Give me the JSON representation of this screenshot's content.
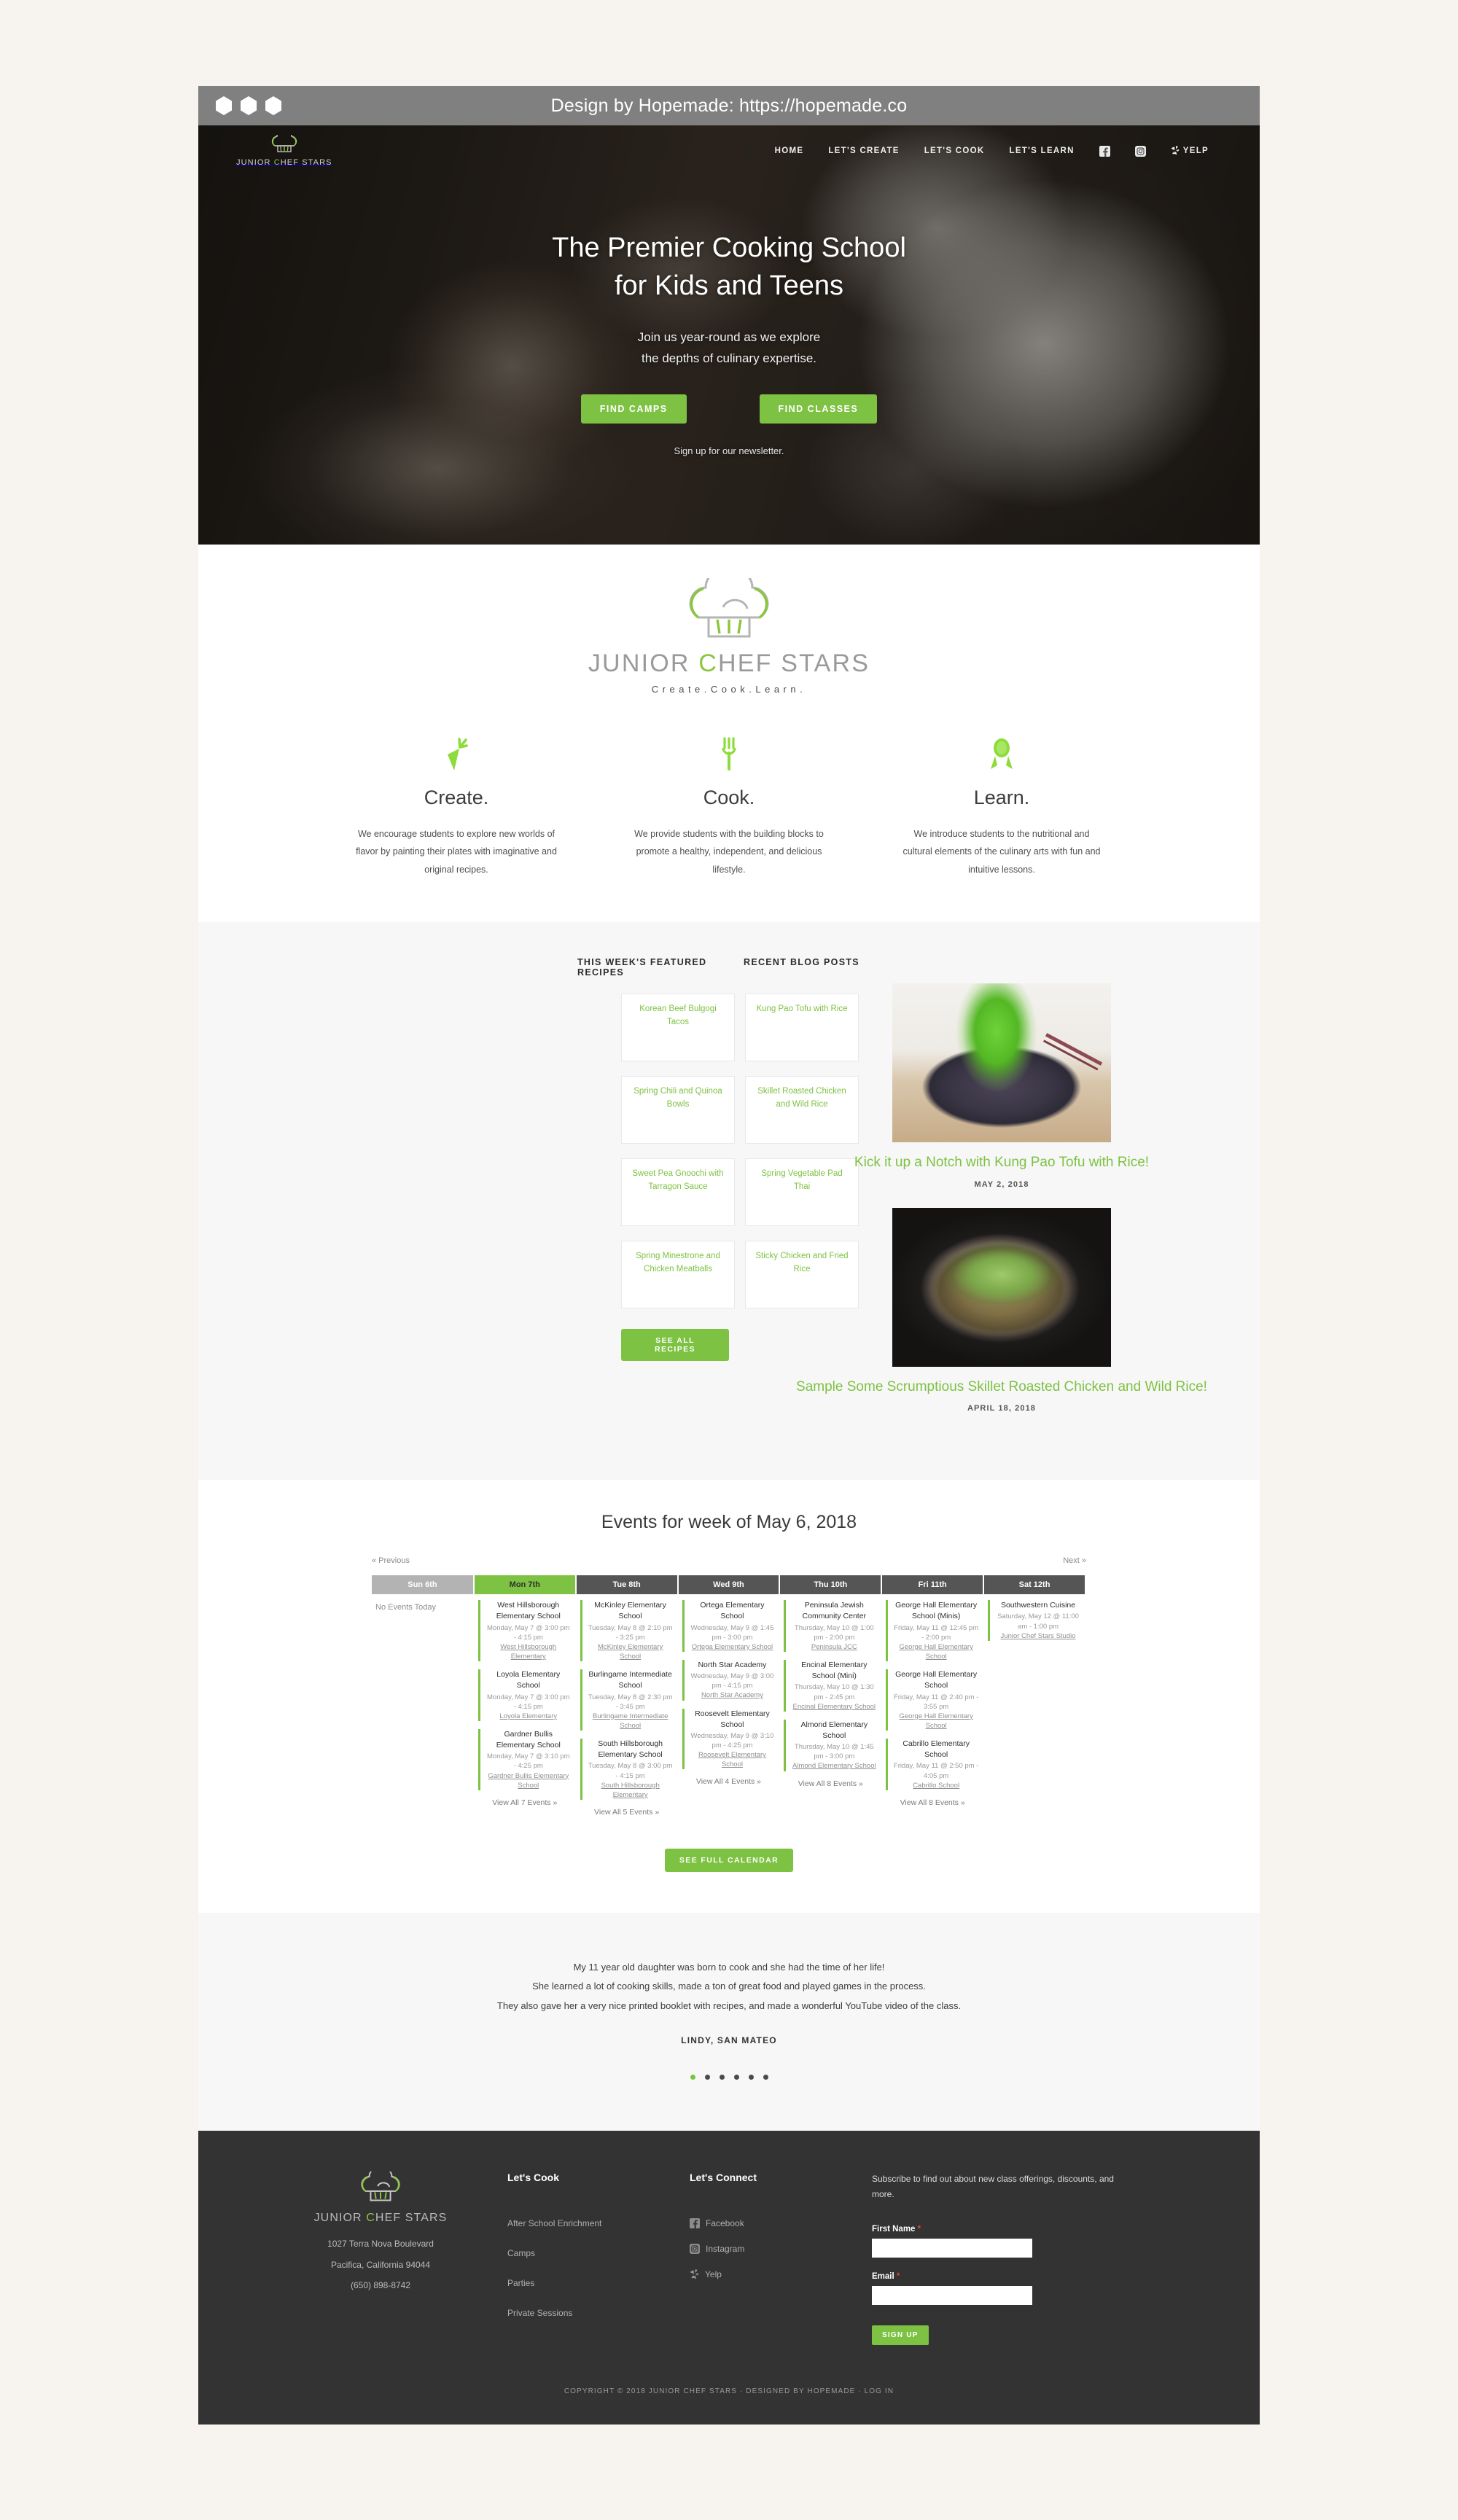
{
  "browser": {
    "title_bar_text": "Design by Hopemade: https://hopemade.co"
  },
  "header": {
    "logo_word_1": "JUNIOR ",
    "logo_word_accent": "C",
    "logo_word_2": "HEF STARS",
    "nav": [
      {
        "label": "HOME",
        "name": "nav-home"
      },
      {
        "label": "LET'S CREATE",
        "name": "nav-lets-create"
      },
      {
        "label": "LET'S COOK",
        "name": "nav-lets-cook"
      },
      {
        "label": "LET'S LEARN",
        "name": "nav-lets-learn"
      }
    ],
    "social": [
      {
        "label": "facebook-icon"
      },
      {
        "label": "instagram-icon"
      },
      {
        "label": "YELP"
      }
    ]
  },
  "hero": {
    "title_line1": "The Premier Cooking School",
    "title_line2": "for Kids and Teens",
    "sub_line1": "Join us year-round as we explore",
    "sub_line2": "the depths of culinary expertise.",
    "btn_camps": "FIND CAMPS",
    "btn_classes": "FIND CLASSES",
    "newsletter_link": "Sign up for our newsletter."
  },
  "intro": {
    "logo_word_1": "JUNIOR ",
    "logo_word_accent": "C",
    "logo_word_2": "HEF STARS",
    "tagline": "Create.Cook.Learn.",
    "columns": [
      {
        "icon": "carrot-icon",
        "title": "Create.",
        "body": "We encourage students to explore new worlds of flavor by painting their plates with imaginative and original recipes."
      },
      {
        "icon": "fork-icon",
        "title": "Cook.",
        "body": "We provide students with the building blocks to promote a healthy, independent, and delicious lifestyle."
      },
      {
        "icon": "award-ribbon-icon",
        "title": "Learn.",
        "body": "We introduce students to the nutritional and cultural elements of the culinary arts with fun and intuitive lessons."
      }
    ]
  },
  "recipes": {
    "heading": "THIS WEEK'S FEATURED RECIPES",
    "items": [
      "Korean Beef Bulgogi Tacos",
      "Kung Pao Tofu with Rice",
      "Spring Chili and Quinoa Bowls",
      "Skillet Roasted Chicken and Wild Rice",
      "Sweet Pea Gnoochi with Tarragon Sauce",
      "Spring Vegetable Pad Thai",
      "Spring Minestrone and Chicken Meatballs",
      "Sticky Chicken and Fried Rice"
    ],
    "button": "SEE ALL RECIPES"
  },
  "blog": {
    "heading": "RECENT BLOG POSTS",
    "posts": [
      {
        "title": "Kick it up a Notch with Kung Pao Tofu with Rice!",
        "date": "MAY 2, 2018",
        "image": "kung-pao-tofu-bowl-photo"
      },
      {
        "title": "Sample Some Scrumptious Skillet Roasted Chicken and Wild Rice!",
        "date": "APRIL 18, 2018",
        "image": "skillet-roasted-chicken-photo"
      }
    ]
  },
  "calendar": {
    "title": "Events for week of May 6, 2018",
    "prev": "« Previous",
    "next": "Next »",
    "button": "SEE FULL CALENDAR",
    "days": [
      {
        "header": "Sun 6th",
        "state": "past",
        "empty_text": "No Events Today",
        "events": [],
        "view_all": ""
      },
      {
        "header": "Mon 7th",
        "state": "today",
        "empty_text": "",
        "events": [
          {
            "name": "West Hillsborough Elementary School",
            "time": "Monday, May 7 @ 3:00 pm - 4:15 pm",
            "venue": "West Hillsborough Elementary"
          },
          {
            "name": "Loyola Elementary School",
            "time": "Monday, May 7 @ 3:00 pm - 4:15 pm",
            "venue": "Loyola Elementary"
          },
          {
            "name": "Gardner Bullis Elementary School",
            "time": "Monday, May 7 @ 3:10 pm - 4:25 pm",
            "venue": "Gardner Bullis Elementary School"
          }
        ],
        "view_all": "View All 7 Events »"
      },
      {
        "header": "Tue 8th",
        "state": "normal",
        "empty_text": "",
        "events": [
          {
            "name": "McKinley Elementary School",
            "time": "Tuesday, May 8 @ 2:10 pm - 3:25 pm",
            "venue": "McKinley Elementary School"
          },
          {
            "name": "Burlingame Intermediate School",
            "time": "Tuesday, May 8 @ 2:30 pm - 3:45 pm",
            "venue": "Burlingame Intermediate School"
          },
          {
            "name": "South Hillsborough Elementary School",
            "time": "Tuesday, May 8 @ 3:00 pm - 4:15 pm",
            "venue": "South Hillsborough Elementary"
          }
        ],
        "view_all": "View All 5 Events »"
      },
      {
        "header": "Wed 9th",
        "state": "normal",
        "empty_text": "",
        "events": [
          {
            "name": "Ortega Elementary School",
            "time": "Wednesday, May 9 @ 1:45 pm - 3:00 pm",
            "venue": "Ortega Elementary School"
          },
          {
            "name": "North Star Academy",
            "time": "Wednesday, May 9 @ 3:00 pm - 4:15 pm",
            "venue": "North Star Academy"
          },
          {
            "name": "Roosevelt Elementary School",
            "time": "Wednesday, May 9 @ 3:10 pm - 4:25 pm",
            "venue": "Roosevelt Elementary School"
          }
        ],
        "view_all": "View All 4 Events »"
      },
      {
        "header": "Thu 10th",
        "state": "normal",
        "empty_text": "",
        "events": [
          {
            "name": "Peninsula Jewish Community Center",
            "time": "Thursday, May 10 @ 1:00 pm - 2:00 pm",
            "venue": "Peninsula JCC"
          },
          {
            "name": "Encinal Elementary School (Mini)",
            "time": "Thursday, May 10 @ 1:30 pm - 2:45 pm",
            "venue": "Encinal Elementary School"
          },
          {
            "name": "Almond Elementary School",
            "time": "Thursday, May 10 @ 1:45 pm - 3:00 pm",
            "venue": "Almond Elementary School"
          }
        ],
        "view_all": "View All 8 Events »"
      },
      {
        "header": "Fri 11th",
        "state": "normal",
        "empty_text": "",
        "events": [
          {
            "name": "George Hall Elementary School (Minis)",
            "time": "Friday, May 11 @ 12:45 pm - 2:00 pm",
            "venue": "George Hall Elementary School"
          },
          {
            "name": "George Hall Elementary School",
            "time": "Friday, May 11 @ 2:40 pm - 3:55 pm",
            "venue": "George Hall Elementary School"
          },
          {
            "name": "Cabrillo Elementary School",
            "time": "Friday, May 11 @ 2:50 pm - 4:05 pm",
            "venue": "Cabrillo School"
          }
        ],
        "view_all": "View All 8 Events »"
      },
      {
        "header": "Sat 12th",
        "state": "normal",
        "empty_text": "",
        "events": [
          {
            "name": "Southwestern Cuisine",
            "time": "Saturday, May 12 @ 11:00 am - 1:00 pm",
            "venue": "Junior Chef Stars Studio"
          }
        ],
        "view_all": ""
      }
    ]
  },
  "testimonial": {
    "line1": "My 11 year old daughter was born to cook and she had the time of her life!",
    "line2": "She learned a lot of cooking skills, made a ton of great food and played games in the process.",
    "line3": "They also gave her a very nice printed booklet with recipes, and made a wonderful YouTube video of the class.",
    "author": "LINDY, SAN MATEO",
    "dot_count": 6,
    "active_dot": 0
  },
  "footer": {
    "logo_word_1": "JUNIOR ",
    "logo_word_accent": "C",
    "logo_word_2": "HEF STARS",
    "address_line1": "1027 Terra Nova Boulevard",
    "address_line2": "Pacifica, California 94044",
    "phone": "(650) 898-8742",
    "cook_heading": "Let's Cook",
    "cook_links": [
      "After School Enrichment",
      "Camps",
      "Parties",
      "Private Sessions"
    ],
    "connect_heading": "Let's Connect",
    "connect_links": [
      "Facebook",
      "Instagram",
      "Yelp"
    ],
    "subscribe_text": "Subscribe to find out about new class offerings, discounts, and more.",
    "first_name_label": "First Name",
    "first_name_value": "",
    "email_label": "Email",
    "email_value": "",
    "required_mark": "*",
    "signup_button": "SIGN UP",
    "copyright": "COPYRIGHT © 2018 JUNIOR CHEF STARS · DESIGNED BY HOPEMADE · LOG IN"
  },
  "colors": {
    "accent_green": "#7dc242",
    "dark_footer": "#333333",
    "page_bg": "#f7f4ef"
  }
}
